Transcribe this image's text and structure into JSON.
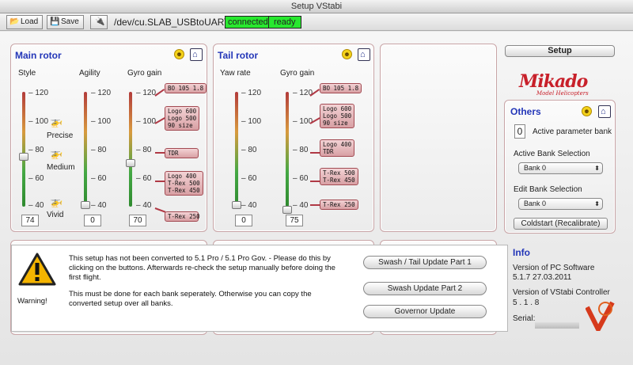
{
  "window": {
    "title": "Setup VStabi"
  },
  "toolbar": {
    "load_label": "Load",
    "save_label": "Save",
    "port": "/dev/cu.SLAB_USBtoUART",
    "status_connected": "connected",
    "status_ready": "ready"
  },
  "main_rotor": {
    "title": "Main rotor",
    "style": {
      "label": "Style",
      "value": "74",
      "ticks": [
        "120",
        "100",
        "80",
        "60",
        "40"
      ],
      "presets": [
        "Precise",
        "Medium",
        "Vivid"
      ]
    },
    "agility": {
      "label": "Agility",
      "value": "0",
      "ticks": [
        "120",
        "100",
        "80",
        "60",
        "40"
      ]
    },
    "gyro": {
      "label": "Gyro gain",
      "value": "70",
      "ticks": [
        "120",
        "100",
        "80",
        "60",
        "40"
      ],
      "tags": [
        "BO 105 1.8",
        "Logo 600\nLogo 500\n90 size",
        "TDR",
        "Logo 400\nT-Rex 500\nT-Rex 450",
        "T-Rex 250"
      ]
    }
  },
  "tail_rotor": {
    "title": "Tail rotor",
    "yaw": {
      "label": "Yaw rate",
      "value": "0",
      "ticks": [
        "120",
        "100",
        "80",
        "60",
        "40"
      ]
    },
    "gyro": {
      "label": "Gyro gain",
      "value": "75",
      "ticks": [
        "120",
        "100",
        "80",
        "60",
        "40"
      ],
      "tags": [
        "BO 105 1.8",
        "Logo 600\nLogo 500\n90 size",
        "Logo 400\nTDR",
        "T-Rex 500\nT-Rex 450",
        "T-Rex 250"
      ]
    }
  },
  "sidebar": {
    "setup_label": "Setup",
    "logo": "Mikado",
    "logo_sub": "Model Helicopters",
    "others_title": "Others",
    "active_bank_value": "0",
    "active_bank_label": "Active parameter bank",
    "active_sel_label": "Active Bank Selection",
    "active_sel_value": "Bank 0",
    "edit_sel_label": "Edit Bank Selection",
    "edit_sel_value": "Bank 0",
    "coldstart_label": "Coldstart (Recalibrate)",
    "info_title": "Info",
    "pc_label": "Version of PC Software",
    "pc_value": "5.1.7  27.03.2011",
    "ctrl_label": "Version of VStabi Controller",
    "ctrl_value": "5 . 1 . 8",
    "serial_label": "Serial:"
  },
  "warning": {
    "caption": "Warning!",
    "line1": "This setup has not been converted to 5.1 Pro / 5.1 Pro Gov. - Please do this by",
    "line2": "clicking on the buttons. Afterwards re-check the setup manually before doing the",
    "line3": "first flight.",
    "line4": "This must be done for each bank seperately. Otherwise you can copy the",
    "line5": "converted setup over all banks.",
    "btn1": "Swash / Tail Update Part 1",
    "btn2": "Swash Update Part 2",
    "btn3": "Governor Update"
  },
  "colors": {
    "status_green": "#28e82e",
    "accent_blue": "#2336b8",
    "brand_red": "#c8202a"
  }
}
